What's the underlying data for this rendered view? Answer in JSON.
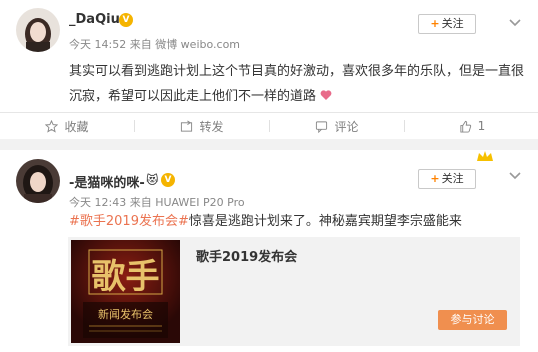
{
  "post1": {
    "username": "_DaQiu",
    "meta": "今天 14:52 来自 微博 weibo.com",
    "follow_label": "关注",
    "text_line1": "其实可以看到逃跑计划上这个节目真的好激动，喜欢很多年的乐队，但是一直很",
    "text_line2": "沉寂，希望可以因此走上他们不一样的道路",
    "actions": {
      "favorite": "收藏",
      "repost": "转发",
      "comment": "评论",
      "like": "1"
    }
  },
  "post2": {
    "username": "-是猫咪的咪-",
    "meta": "今天 12:43 来自 HUAWEI P20 Pro",
    "follow_label": "关注",
    "hashtag": "#歌手2019发布会#",
    "text_rest": "惊喜是逃跑计划来了。神秘嘉宾期望李宗盛能来",
    "card": {
      "title": "歌手2019发布会",
      "button": "参与讨论",
      "poster_title": "歌手",
      "poster_sub": "新闻发布会"
    }
  },
  "colors": {
    "accent": "#ff8200",
    "hashtag": "#eb7350",
    "button": "#f08f4f"
  }
}
